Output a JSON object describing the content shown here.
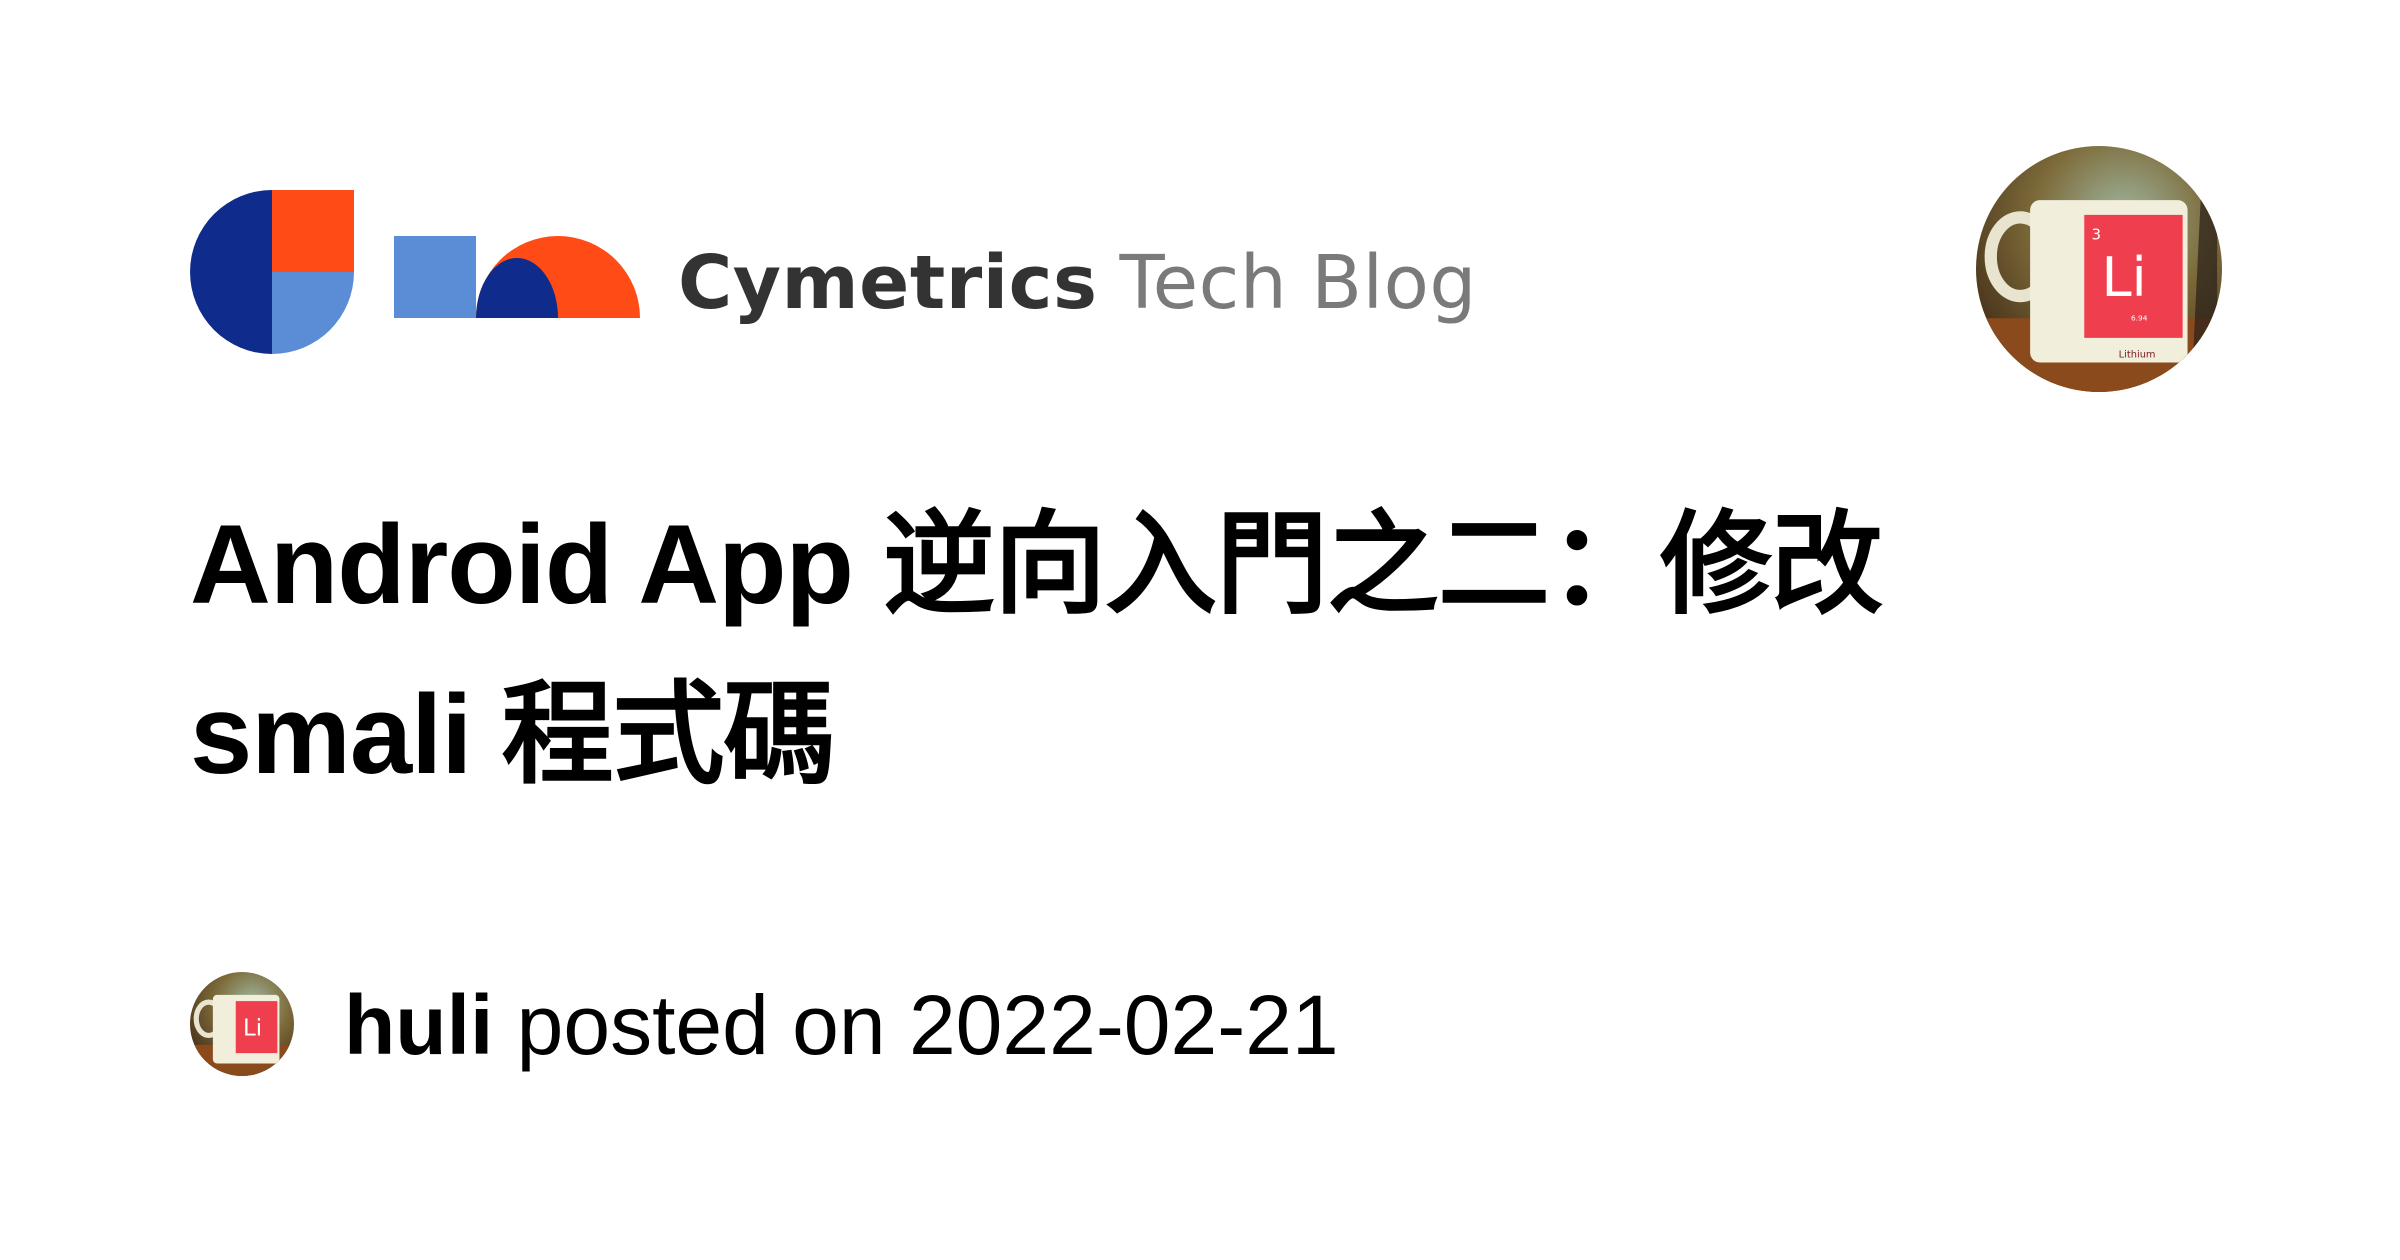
{
  "brand": {
    "name": "Cymetrics",
    "suffix": "Tech Blog",
    "colors": {
      "navy": "#0f2b8c",
      "orange": "#ff4b16",
      "blue": "#5b8cd6"
    }
  },
  "post": {
    "title": "Android App 逆向入門之二：修改 smali 程式碼",
    "author": "huli",
    "posted_text": " posted on ",
    "date": "2022-02-21"
  },
  "avatar": {
    "icon": "mug-photo",
    "mug_symbol": "Li",
    "mug_number": "3",
    "mug_mass": "6.94",
    "mug_element": "Lithium"
  }
}
